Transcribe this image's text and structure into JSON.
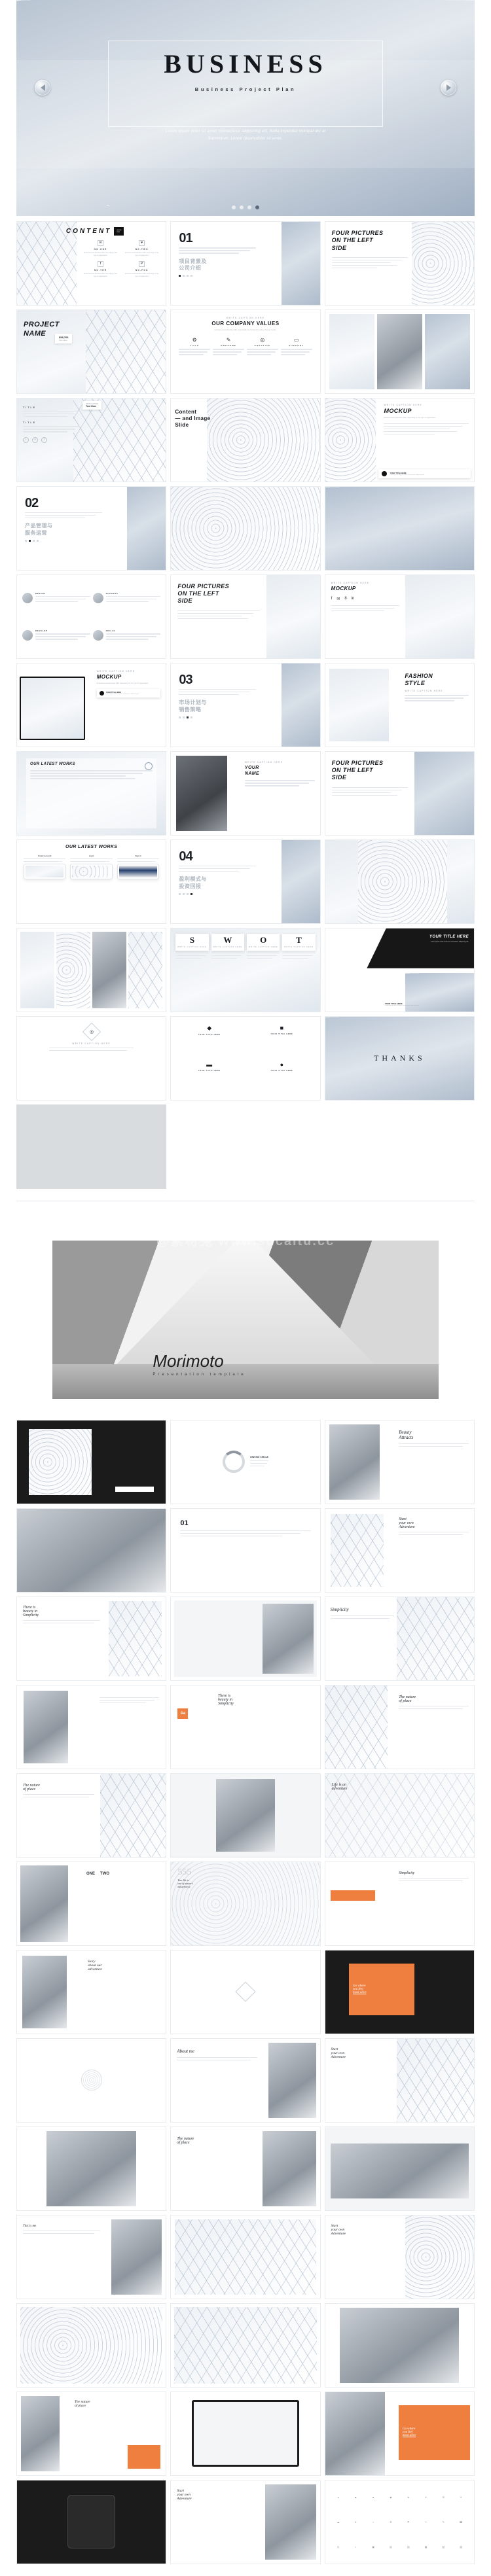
{
  "watermark": "@素材兔 www.sucaitu.cc",
  "deck1": {
    "hero": {
      "title": "BUSINESS",
      "subtitle": "Business Project Plan",
      "description_line1": "Lorem ipsum dolor sit amet, consectetur adipiscing elit. Nulla imperdiet volutpat dui at",
      "description_line2": "fermentum. Lorem ipsum dolor sit amet.",
      "prev_label": "Previous",
      "next_label": "Next",
      "dots": [
        "1",
        "2",
        "3",
        "4"
      ],
      "active_dot": 3
    },
    "slides": [
      {
        "id": "content-toc",
        "kind": "toc",
        "title": "CONTENT",
        "items": [
          {
            "label": "NO.ONE",
            "icon": "twitter-icon",
            "glyph": "✉",
            "desc": "Entrepreneurial activities differ depending on the type of organization"
          },
          {
            "label": "NO.TWO",
            "icon": "heart-icon",
            "glyph": "♥",
            "desc": "Entrepreneurial activities differ depending on the type of organization"
          },
          {
            "label": "NO.THR",
            "icon": "facebook-icon",
            "glyph": "f",
            "desc": "Entrepreneurial activities differ depending on the type of organization"
          },
          {
            "label": "NO.FOU",
            "icon": "pinterest-icon",
            "glyph": "P",
            "desc": "Entrepreneurial activities differ depending on the type of organization"
          }
        ]
      },
      {
        "id": "section-01",
        "kind": "section",
        "number": "01",
        "cn_title_1": "项目背景及",
        "cn_title_2": "公司介绍",
        "caption": "Entrepreneurial activities differ depending on the type of organization",
        "active_dot": 0
      },
      {
        "id": "four-pictures-left-1",
        "kind": "fourpic",
        "title_1": "FOUR PICTURES",
        "title_2": "ON THE LEFT",
        "title_3": "SIDE",
        "body": "Entrepreneurial activities differ substantially depending on the type of organization and creativity involved."
      },
      {
        "id": "project-name",
        "kind": "project",
        "title_1": "PROJECT",
        "title_2": "NAME",
        "badge_value": "$58,766",
        "badge_label": "Text Here"
      },
      {
        "id": "company-values",
        "kind": "values",
        "eyebrow": "WRITE CAPTION HERE",
        "title": "OUR COMPANY VALUES",
        "intro": "Entrepreneurial activities differ substantially and creativity involved. Deliver results.",
        "columns": [
          {
            "label": "TITLE",
            "icon": "gear-icon",
            "glyph": "⚙"
          },
          {
            "label": "AWESOME",
            "icon": "clip-icon",
            "glyph": "✐"
          },
          {
            "label": "CREATIVE",
            "icon": "bulb-icon",
            "glyph": "◎"
          },
          {
            "label": "SUPPORT",
            "icon": "chat-icon",
            "glyph": "□"
          }
        ]
      },
      {
        "id": "image-grid-1",
        "kind": "imagegrid"
      },
      {
        "id": "title-text-slide",
        "kind": "titletext",
        "bubble_eyebrow": "WRITE CAPTION",
        "bubble_text": "Text Here",
        "block_1_title": "TITLE",
        "block_1_body": "Entrepreneurial activities differ substantially depending on the type of organization.",
        "block_2_title": "TITLE",
        "block_2_body": "Entrepreneurial activities differ substantially depending on the type of organization.",
        "buttons": [
          "download-icon",
          "info-icon",
          "upload-icon"
        ]
      },
      {
        "id": "content-image-slide",
        "kind": "contentimage",
        "title_1": "Content",
        "title_2": "— and Image",
        "title_3": "Slide"
      },
      {
        "id": "mockup-1",
        "kind": "mockup",
        "eyebrow": "WRITE CAPTION HERE",
        "title": "MOCKUP",
        "intro": "Entrepreneurial activities differ depending on the type of organization",
        "body": "Entrepreneurial activities differ substantially depending on the type of organization and creativity involved.",
        "footer_title": "YOUR TITLE HERE",
        "footer_body": "Lorem ipsum dolor sit amet, consectetur adipiscing elit."
      },
      {
        "id": "section-02",
        "kind": "section",
        "number": "02",
        "cn_title_1": "产品管理与",
        "cn_title_2": "服务运营",
        "caption": "Entrepreneurial activities differ depending on the type of organization",
        "active_dot": 1
      },
      {
        "id": "spiral-image-1",
        "kind": "photo"
      },
      {
        "id": "wave-image-1",
        "kind": "photo"
      },
      {
        "id": "team-four",
        "kind": "team",
        "members": [
          {
            "name": "DESIGN",
            "desc": "There are many variations of passages of Lorem Ipsum available."
          },
          {
            "name": "SUCCESS",
            "desc": "There are many variations of passages of Lorem Ipsum available."
          },
          {
            "name": "DEVELOP",
            "desc": "There are many variations of passages of Lorem Ipsum available."
          },
          {
            "name": "SKILLS",
            "desc": "There are many variations of passages of Lorem Ipsum available."
          }
        ]
      },
      {
        "id": "four-pictures-left-2",
        "kind": "fourpic",
        "title_1": "FOUR PICTURES",
        "title_2": "ON THE LEFT",
        "title_3": "SIDE",
        "body": "Entrepreneurial activities differ substantially depending on the type of organization."
      },
      {
        "id": "mockup-social",
        "kind": "mockupsocial",
        "eyebrow": "WRITE CAPTION HERE",
        "title": "MOCKUP",
        "socials": [
          {
            "label": "f",
            "icon": "facebook-icon"
          },
          {
            "label": "✉",
            "icon": "twitter-icon"
          },
          {
            "label": "8",
            "icon": "google-icon"
          },
          {
            "label": "in",
            "icon": "linkedin-icon"
          }
        ]
      },
      {
        "id": "mockup-laptop",
        "kind": "mockuplaptop",
        "eyebrow": "WRITE CAPTION HERE",
        "title": "MOCKUP",
        "intro": "Entrepreneurial activities differ depending on the type of organization",
        "footer_title": "YOUR TITLE HERE",
        "footer_body": "Lorem ipsum dolor sit amet, consectetur adipiscing elit."
      },
      {
        "id": "section-03",
        "kind": "section",
        "number": "03",
        "cn_title_1": "市场计划与",
        "cn_title_2": "销售策略",
        "caption": "Entrepreneurial activities differ depending on the type of organization",
        "active_dot": 2
      },
      {
        "id": "fashion-style",
        "kind": "fashion",
        "title_1": "FASHION",
        "title_2": "STYLE",
        "eyebrow": "WRITE CAPTION HERE",
        "body": "Entrepreneurial activities differ substantially depending on the type of organization."
      },
      {
        "id": "latest-works-1",
        "kind": "works",
        "title": "OUR LATEST WORKS",
        "body": "Entrepreneurial activities differ substantially depending on the type of organization and creativity involved."
      },
      {
        "id": "person-profile",
        "kind": "profile",
        "eyebrow": "WRITE CAPTION HERE",
        "name_1": "YOUR",
        "name_2": "NAME",
        "body": "There are many variations of passages of Lorem Ipsum available."
      },
      {
        "id": "four-pictures-left-3",
        "kind": "fourpic",
        "title_1": "FOUR PICTURES",
        "title_2": "ON THE LEFT",
        "title_3": "SIDE",
        "body": "Entrepreneurial activities differ substantially depending on the type of organization."
      },
      {
        "id": "latest-works-2",
        "kind": "worksphone",
        "title": "OUR LATEST WORKS",
        "phones": [
          {
            "label": "Create Account",
            "desc": "There are many variations of passages of Lorem Ipsum available."
          },
          {
            "label": "Login",
            "desc": "There are many variations of passages of Lorem Ipsum available."
          },
          {
            "label": "Sign in",
            "desc": "There are many variations of passages of Lorem Ipsum available."
          }
        ]
      },
      {
        "id": "section-04",
        "kind": "section",
        "number": "04",
        "cn_title_1": "盈利模式与",
        "cn_title_2": "投资回报",
        "caption": "Entrepreneurial activities differ depending on the type of organization",
        "active_dot": 3
      },
      {
        "id": "columns-image",
        "kind": "photo"
      },
      {
        "id": "gallery-strip",
        "kind": "gallery"
      },
      {
        "id": "swot-analysis",
        "kind": "swot",
        "letters": [
          {
            "letter": "S",
            "caption": "WRITE CAPTION HERE",
            "body": "The user can demonstrate all it contains or complete as with the presentation."
          },
          {
            "letter": "W",
            "caption": "WRITE CAPTION HERE",
            "body": "The user can demonstrate all it contains or complete as with the presentation."
          },
          {
            "letter": "O",
            "caption": "WRITE CAPTION HERE",
            "body": "The user can demonstrate all it contains or complete as with the presentation."
          },
          {
            "letter": "T",
            "caption": "WRITE CAPTION HERE",
            "body": "The user can demonstrate all it contains or complete as with the presentation."
          }
        ]
      },
      {
        "id": "your-title-dark",
        "kind": "darkbanner",
        "title": "YOUR TITLE HERE",
        "body": "Lorem ipsum dolor sit amet, consectetur adipiscing elit.",
        "footer_title": "YOUR TITLE HERE",
        "footer_body": "Lorem ipsum dolor sit amet, consectetur adipiscing elit."
      },
      {
        "id": "diamond-idea",
        "kind": "diamond",
        "icon": "bulb-icon",
        "eyebrow": "WRITE CAPTION HERE",
        "body": "Entrepreneurial activities differ substantially depending on the type of organization."
      },
      {
        "id": "icon-features",
        "kind": "icons",
        "items": [
          {
            "label": "YOUR TITLE HERE",
            "icon": "diamond-icon",
            "glyph": "◆"
          },
          {
            "label": "YOUR TITLE HERE",
            "icon": "cube-icon",
            "glyph": "■"
          },
          {
            "label": "YOUR TITLE HERE",
            "icon": "bag-icon",
            "glyph": "▬"
          },
          {
            "label": "YOUR TITLE HERE",
            "icon": "globe-icon",
            "glyph": "●"
          }
        ]
      },
      {
        "id": "thanks",
        "kind": "thanks",
        "title": "THANKS"
      },
      {
        "id": "blank-end",
        "kind": "blank"
      }
    ]
  },
  "deck2": {
    "hero": {
      "title": "Morimoto",
      "subtitle": "Presentation template"
    },
    "slides": [
      {
        "id": "m-dark-photo",
        "kind": "m-dark"
      },
      {
        "id": "m-circle-chart",
        "kind": "m-circle",
        "title": "ONE BIG CIRCLE",
        "body": "Lorem ipsum dolor sit amet consectetur"
      },
      {
        "id": "m-beauty",
        "kind": "m-text",
        "title_1": "Beauty",
        "title_2": "Attracts",
        "body": "Lorem ipsum dolor sit amet, consectetur adipiscing elit."
      },
      {
        "id": "m-lamp",
        "kind": "m-photo"
      },
      {
        "id": "m-01",
        "kind": "m-num",
        "number": "01",
        "body": "Lorem ipsum dolor sit amet, consectetur adipiscing elit."
      },
      {
        "id": "m-start-adventure-1",
        "kind": "m-card",
        "title_1": "Start",
        "title_2": "your own",
        "title_3": "Adventure",
        "body": "Lorem ipsum dolor sit amet"
      },
      {
        "id": "m-beauty-simplicity-1",
        "kind": "m-quote",
        "title_1": "There is",
        "title_2": "beauty in",
        "title_3": "Simplicity",
        "body": "Lorem ipsum dolor sit amet"
      },
      {
        "id": "m-stairs",
        "kind": "m-photo"
      },
      {
        "id": "m-simplicity",
        "kind": "m-text",
        "title_1": "Simplicity",
        "body": "Lorem ipsum dolor sit amet, consectetur adipiscing elit."
      },
      {
        "id": "m-frame",
        "kind": "m-photo"
      },
      {
        "id": "m-orange-beauty",
        "kind": "m-accent",
        "badge": "Aa",
        "title_1": "There is",
        "title_2": "beauty in",
        "title_3": "Simplicity"
      },
      {
        "id": "m-nature-place-1",
        "kind": "m-text",
        "title_1": "The nature",
        "title_2": "of place",
        "body": "Lorem ipsum dolor sit amet"
      },
      {
        "id": "m-nature-place-2",
        "kind": "m-text",
        "title_1": "The nature",
        "title_2": "of place",
        "body": "Lorem ipsum dolor sit amet"
      },
      {
        "id": "m-person-walk",
        "kind": "m-photo"
      },
      {
        "id": "m-life-adventure",
        "kind": "m-quote",
        "title_1": "Life is an",
        "title_2": "adventure",
        "body": "Lorem ipsum dolor sit amet"
      },
      {
        "id": "m-big-numbers",
        "kind": "m-num2",
        "number_1": "ONE",
        "number_2": "TWO"
      },
      {
        "id": "m-555",
        "kind": "m-bignum",
        "number": "555",
        "title_1": "Your life is",
        "title_2": "one of nature's",
        "title_3": "masterpiece",
        "body": "Lorem ipsum dolor sit amet"
      },
      {
        "id": "m-simplicity-2",
        "kind": "m-accent2",
        "title": "Simplicity",
        "body": "Lorem ipsum dolor sit amet, consectetur"
      },
      {
        "id": "m-story-adventure",
        "kind": "m-card",
        "title_1": "Story",
        "title_2": "about our",
        "title_3": "adventure",
        "body": "Lorem ipsum dolor sit amet"
      },
      {
        "id": "m-bag-diagram",
        "kind": "m-diagram"
      },
      {
        "id": "m-go-where",
        "kind": "m-accentdark",
        "title_1": "Go where",
        "title_2": "you feel",
        "title_3": "most alive"
      },
      {
        "id": "m-circular",
        "kind": "m-circle2"
      },
      {
        "id": "m-about-me",
        "kind": "m-text",
        "title_1": "About me",
        "body": "Lorem ipsum dolor sit amet, consectetur adipiscing elit."
      },
      {
        "id": "m-start-adventure-2",
        "kind": "m-card",
        "title_1": "Start",
        "title_2": "your own",
        "title_3": "Adventure",
        "body": "Lorem ipsum dolor sit amet"
      },
      {
        "id": "m-stairs-2",
        "kind": "m-photo"
      },
      {
        "id": "m-nature-place-3",
        "kind": "m-text",
        "title_1": "The nature",
        "title_2": "of place",
        "body": "Lorem ipsum dolor sit amet"
      },
      {
        "id": "m-sofa",
        "kind": "m-photo"
      },
      {
        "id": "m-this-is-me",
        "kind": "m-text",
        "title_1": "This is me",
        "body": "Lorem ipsum dolor sit amet, consectetur adipiscing elit."
      },
      {
        "id": "m-plant",
        "kind": "m-photo"
      },
      {
        "id": "m-start-adventure-3",
        "kind": "m-card",
        "title_1": "Start",
        "title_2": "your own",
        "title_3": "Adventure",
        "body": "Lorem ipsum dolor sit amet"
      },
      {
        "id": "m-arch",
        "kind": "m-photo"
      },
      {
        "id": "m-heart",
        "kind": "m-photo"
      },
      {
        "id": "m-shelf",
        "kind": "m-photo"
      },
      {
        "id": "m-nature-orange",
        "kind": "m-accent3",
        "title_1": "The nature",
        "title_2": "of place"
      },
      {
        "id": "m-tablet-dark",
        "kind": "m-device"
      },
      {
        "id": "m-go-where-2",
        "kind": "m-accentdark",
        "title_1": "Go where",
        "title_2": "you feel",
        "title_3": "most alive"
      },
      {
        "id": "m-watch",
        "kind": "m-device"
      },
      {
        "id": "m-start-adventure-4",
        "kind": "m-card",
        "title_1": "Start",
        "title_2": "your own",
        "title_3": "Adventure",
        "body": "Lorem ipsum dolor sit amet"
      },
      {
        "id": "m-ereader",
        "kind": "m-device"
      },
      {
        "id": "m-icon-sheet",
        "kind": "m-icons"
      }
    ]
  }
}
